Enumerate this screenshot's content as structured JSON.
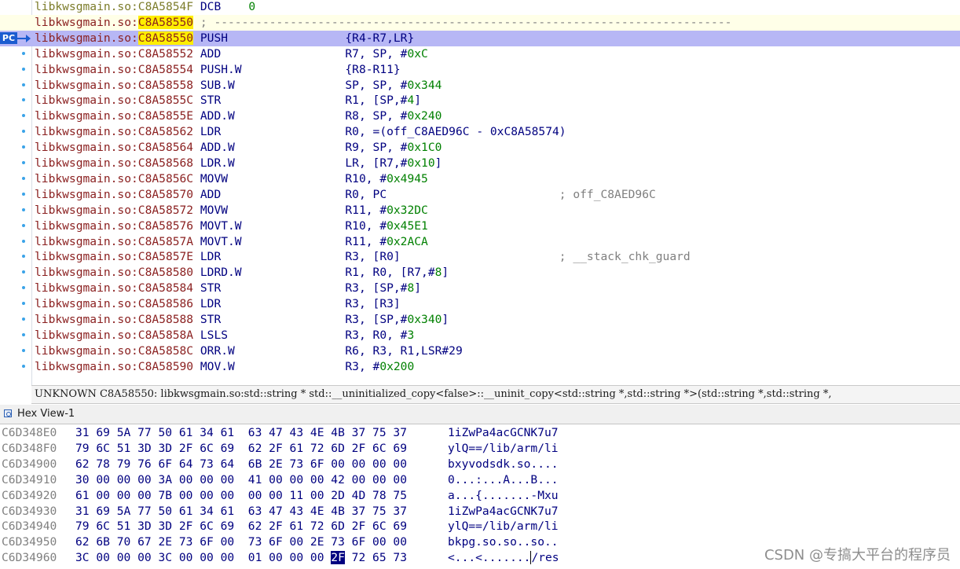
{
  "disasm": {
    "top_line": {
      "seg": "libkwsgmain.so:",
      "addr": "C8A5854F",
      "mnem": "DCB",
      "ops": "0"
    },
    "separator": {
      "seg": "libkwsgmain.so:",
      "addr": "C8A58550",
      "text": "; ---------------------------------------------------------------------------"
    },
    "pc_badge": "PC",
    "lines": [
      {
        "seg": "libkwsgmain.so:",
        "addr": "C8A58550",
        "mnem": "PUSH",
        "ops": "{R4-R7,LR}",
        "cmt": ""
      },
      {
        "seg": "libkwsgmain.so:",
        "addr": "C8A58552",
        "mnem": "ADD",
        "ops": "R7, SP, #",
        "num": "0xC",
        "cmt": ""
      },
      {
        "seg": "libkwsgmain.so:",
        "addr": "C8A58554",
        "mnem": "PUSH.W",
        "ops": "{R8-R11}",
        "cmt": ""
      },
      {
        "seg": "libkwsgmain.so:",
        "addr": "C8A58558",
        "mnem": "SUB.W",
        "ops": "SP, SP, #",
        "num": "0x344",
        "cmt": ""
      },
      {
        "seg": "libkwsgmain.so:",
        "addr": "C8A5855C",
        "mnem": "STR",
        "ops": "R1, [SP,#",
        "num": "4",
        "tail": "]",
        "cmt": ""
      },
      {
        "seg": "libkwsgmain.so:",
        "addr": "C8A5855E",
        "mnem": "ADD.W",
        "ops": "R8, SP, #",
        "num": "0x240",
        "cmt": ""
      },
      {
        "seg": "libkwsgmain.so:",
        "addr": "C8A58562",
        "mnem": "LDR",
        "ops": "R0, =(off_C8AED96C - 0xC8A58574)",
        "cmt": ""
      },
      {
        "seg": "libkwsgmain.so:",
        "addr": "C8A58564",
        "mnem": "ADD.W",
        "ops": "R9, SP, #",
        "num": "0x1C0",
        "cmt": ""
      },
      {
        "seg": "libkwsgmain.so:",
        "addr": "C8A58568",
        "mnem": "LDR.W",
        "ops": "LR, [R7,#",
        "num": "0x10",
        "tail": "]",
        "cmt": ""
      },
      {
        "seg": "libkwsgmain.so:",
        "addr": "C8A5856C",
        "mnem": "MOVW",
        "ops": "R10, #",
        "num": "0x4945",
        "cmt": ""
      },
      {
        "seg": "libkwsgmain.so:",
        "addr": "C8A58570",
        "mnem": "ADD",
        "ops": "R0, PC",
        "cmt": "; off_C8AED96C"
      },
      {
        "seg": "libkwsgmain.so:",
        "addr": "C8A58572",
        "mnem": "MOVW",
        "ops": "R11, #",
        "num": "0x32DC",
        "cmt": ""
      },
      {
        "seg": "libkwsgmain.so:",
        "addr": "C8A58576",
        "mnem": "MOVT.W",
        "ops": "R10, #",
        "num": "0x45E1",
        "cmt": ""
      },
      {
        "seg": "libkwsgmain.so:",
        "addr": "C8A5857A",
        "mnem": "MOVT.W",
        "ops": "R11, #",
        "num": "0x2ACA",
        "cmt": ""
      },
      {
        "seg": "libkwsgmain.so:",
        "addr": "C8A5857E",
        "mnem": "LDR",
        "ops": "R3, [R0]",
        "cmt": "; __stack_chk_guard"
      },
      {
        "seg": "libkwsgmain.so:",
        "addr": "C8A58580",
        "mnem": "LDRD.W",
        "ops": "R1, R0, [R7,#",
        "num": "8",
        "tail": "]",
        "cmt": ""
      },
      {
        "seg": "libkwsgmain.so:",
        "addr": "C8A58584",
        "mnem": "STR",
        "ops": "R3, [SP,#",
        "num": "8",
        "tail": "]",
        "cmt": ""
      },
      {
        "seg": "libkwsgmain.so:",
        "addr": "C8A58586",
        "mnem": "LDR",
        "ops": "R3, [R3]",
        "cmt": ""
      },
      {
        "seg": "libkwsgmain.so:",
        "addr": "C8A58588",
        "mnem": "STR",
        "ops": "R3, [SP,#",
        "num": "0x340",
        "tail": "]",
        "cmt": ""
      },
      {
        "seg": "libkwsgmain.so:",
        "addr": "C8A5858A",
        "mnem": "LSLS",
        "ops": "R3, R0, #",
        "num": "3",
        "cmt": ""
      },
      {
        "seg": "libkwsgmain.so:",
        "addr": "C8A5858C",
        "mnem": "ORR.W",
        "ops": "R6, R3, R1,LSR#29",
        "cmt": ""
      },
      {
        "seg": "libkwsgmain.so:",
        "addr": "C8A58590",
        "mnem": "MOV.W",
        "ops": "R3, #",
        "num": "0x200",
        "cmt": ""
      }
    ]
  },
  "status_line": "UNKNOWN C8A58550: libkwsgmain.so:std::string * std::__uninitialized_copy<false>::__uninit_copy<std::string *,std::string *>(std::string *,std::string *,",
  "hex_view": {
    "tab_label": "Hex View-1",
    "rows": [
      {
        "addr": "C6D348E0",
        "bytes": [
          "31",
          "69",
          "5A",
          "77",
          "50",
          "61",
          "34",
          "61",
          "63",
          "47",
          "43",
          "4E",
          "4B",
          "37",
          "75",
          "37"
        ],
        "ascii": "1iZwPa4acGCNK7u7"
      },
      {
        "addr": "C6D348F0",
        "bytes": [
          "79",
          "6C",
          "51",
          "3D",
          "3D",
          "2F",
          "6C",
          "69",
          "62",
          "2F",
          "61",
          "72",
          "6D",
          "2F",
          "6C",
          "69"
        ],
        "ascii": "ylQ==/lib/arm/li"
      },
      {
        "addr": "C6D34900",
        "bytes": [
          "62",
          "78",
          "79",
          "76",
          "6F",
          "64",
          "73",
          "64",
          "6B",
          "2E",
          "73",
          "6F",
          "00",
          "00",
          "00",
          "00"
        ],
        "ascii": "bxyvodsdk.so...."
      },
      {
        "addr": "C6D34910",
        "bytes": [
          "30",
          "00",
          "00",
          "00",
          "3A",
          "00",
          "00",
          "00",
          "41",
          "00",
          "00",
          "00",
          "42",
          "00",
          "00",
          "00"
        ],
        "ascii": "0...:...A...B..."
      },
      {
        "addr": "C6D34920",
        "bytes": [
          "61",
          "00",
          "00",
          "00",
          "7B",
          "00",
          "00",
          "00",
          "00",
          "00",
          "11",
          "00",
          "2D",
          "4D",
          "78",
          "75"
        ],
        "ascii": "a...{.......-Mxu"
      },
      {
        "addr": "C6D34930",
        "bytes": [
          "31",
          "69",
          "5A",
          "77",
          "50",
          "61",
          "34",
          "61",
          "63",
          "47",
          "43",
          "4E",
          "4B",
          "37",
          "75",
          "37"
        ],
        "ascii": "1iZwPa4acGCNK7u7"
      },
      {
        "addr": "C6D34940",
        "bytes": [
          "79",
          "6C",
          "51",
          "3D",
          "3D",
          "2F",
          "6C",
          "69",
          "62",
          "2F",
          "61",
          "72",
          "6D",
          "2F",
          "6C",
          "69"
        ],
        "ascii": "ylQ==/lib/arm/li"
      },
      {
        "addr": "C6D34950",
        "bytes": [
          "62",
          "6B",
          "70",
          "67",
          "2E",
          "73",
          "6F",
          "00",
          "73",
          "6F",
          "00",
          "2E",
          "73",
          "6F",
          "00",
          "00"
        ],
        "ascii": "bkpg.so.so..so.."
      },
      {
        "addr": "C6D34960",
        "bytes": [
          "3C",
          "00",
          "00",
          "00",
          "3C",
          "00",
          "00",
          "00",
          "01",
          "00",
          "00",
          "00",
          "2F",
          "72",
          "65",
          "73"
        ],
        "ascii": "<...<......./res",
        "selected_byte": 12
      }
    ]
  },
  "watermark": "CSDN @专搞大平台的程序员",
  "colors": {
    "pc_line": "#b7b7f5",
    "address_highlight": "#ffee00",
    "number": "#008000",
    "hex_selection": "#000080"
  }
}
